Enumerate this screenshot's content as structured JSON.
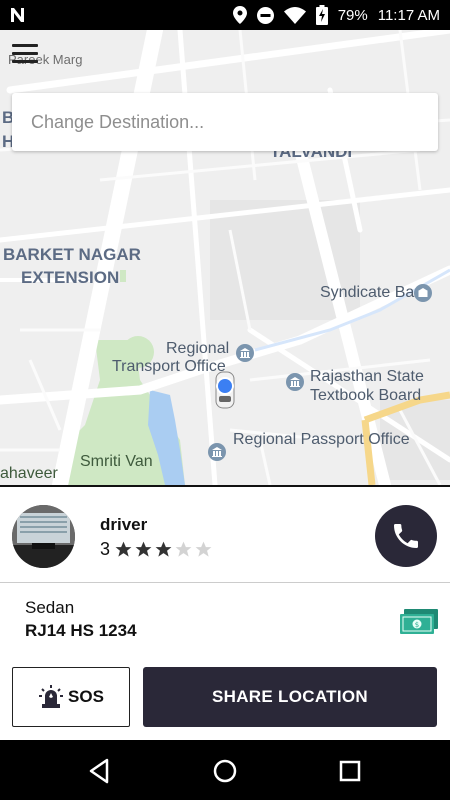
{
  "status_bar": {
    "battery": "79%",
    "time": "11:17 AM",
    "icons": [
      "n-logo-icon",
      "location-icon",
      "dnd-icon",
      "wifi-icon",
      "battery-charging-icon"
    ]
  },
  "map": {
    "labels": {
      "pareek_marg": "Pareek Marg",
      "talvandi": "TALVANDI",
      "barket_1": "BARKET NAGAR",
      "barket_2": "EXTENSION",
      "syndicate_bank": "Syndicate Bank",
      "rto_1": "Regional",
      "rto_2": "Transport Office",
      "rsb_1": "Rajasthan State",
      "rsb_2": "Textbook Board",
      "passport": "Regional Passport Office",
      "smriti_van": "Smriti Van",
      "mahaveer": "ahaveer",
      "edge_b": "B",
      "edge_h": "H"
    }
  },
  "search": {
    "placeholder": "Change Destination..."
  },
  "driver": {
    "name": "driver",
    "rating": "3",
    "stars_filled": 3,
    "stars_total": 5
  },
  "vehicle": {
    "type": "Sedan",
    "plate": "RJ14 HS 1234"
  },
  "actions": {
    "sos_label": "SOS",
    "share_label": "SHARE LOCATION"
  },
  "colors": {
    "primary_dark": "#2a2838",
    "location_dot": "#3b7ff3",
    "cash_green": "#27a08a"
  }
}
